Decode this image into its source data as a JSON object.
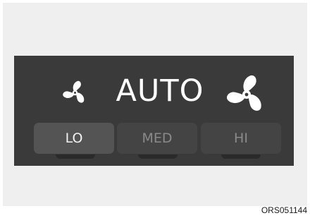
{
  "mode_label": "AUTO",
  "icons": {
    "fan_low": "fan-icon",
    "fan_high": "fan-icon"
  },
  "fan_speed": {
    "options": [
      "LO",
      "MED",
      "HI"
    ],
    "selected": "LO"
  },
  "figure_code": "ORS051144",
  "colors": {
    "panel": "#3a3a3a",
    "selected_button": "#545454",
    "unselected_button": "#444444",
    "selected_text": "#f2f2f2",
    "unselected_text": "#8a8a8a",
    "label_text": "#ffffff"
  }
}
